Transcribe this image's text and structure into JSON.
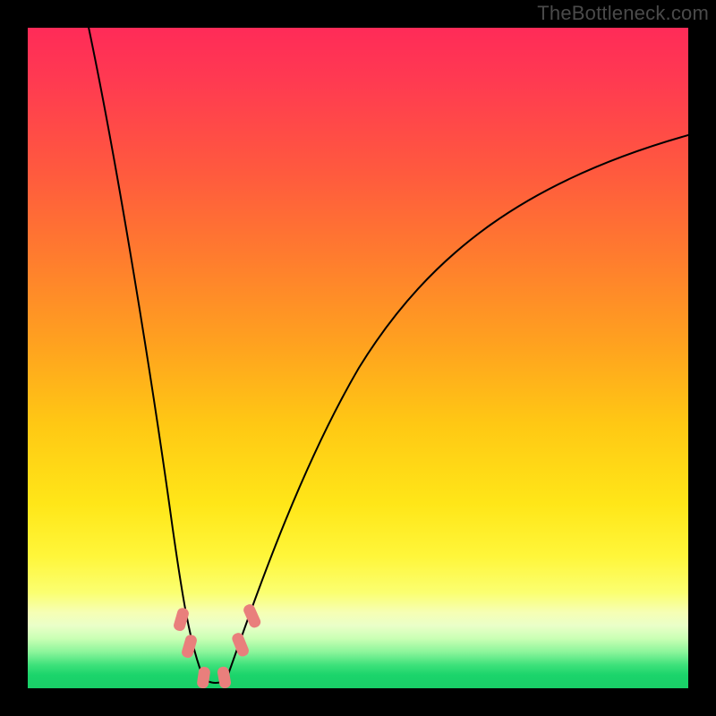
{
  "watermark": "TheBottleneck.com",
  "colors": {
    "background": "#000000",
    "marker": "#e97f7c",
    "curve": "#000000",
    "gradient_top": "#ff2b58",
    "gradient_bottom": "#19cf67"
  },
  "chart_data": {
    "type": "line",
    "title": "",
    "xlabel": "",
    "ylabel": "",
    "xlim": [
      0,
      100
    ],
    "ylim": [
      0,
      100
    ],
    "series": [
      {
        "name": "bottleneck-curve",
        "x": [
          9,
          12,
          15,
          18,
          20,
          22,
          24,
          25,
          26,
          27,
          28,
          29,
          30,
          32,
          35,
          40,
          45,
          50,
          55,
          60,
          65,
          70,
          75,
          80,
          85,
          90,
          95,
          100
        ],
        "values": [
          100,
          84,
          68,
          52,
          41,
          30,
          19,
          13,
          7,
          3,
          1,
          0,
          0,
          1,
          3,
          8,
          15,
          23,
          31,
          39,
          47,
          54,
          61,
          67,
          72,
          77,
          81,
          83
        ]
      }
    ],
    "annotations": {
      "markers": [
        {
          "x": 23.3,
          "y": 6.7,
          "note": "left-slope-upper"
        },
        {
          "x": 24.5,
          "y": 3.0,
          "note": "left-slope-lower"
        },
        {
          "x": 26.5,
          "y": 0.7,
          "note": "valley-left"
        },
        {
          "x": 29.5,
          "y": 0.7,
          "note": "valley-right"
        },
        {
          "x": 32.5,
          "y": 4.3,
          "note": "right-slope-lower"
        },
        {
          "x": 34.0,
          "y": 8.0,
          "note": "right-slope-upper"
        }
      ]
    }
  }
}
